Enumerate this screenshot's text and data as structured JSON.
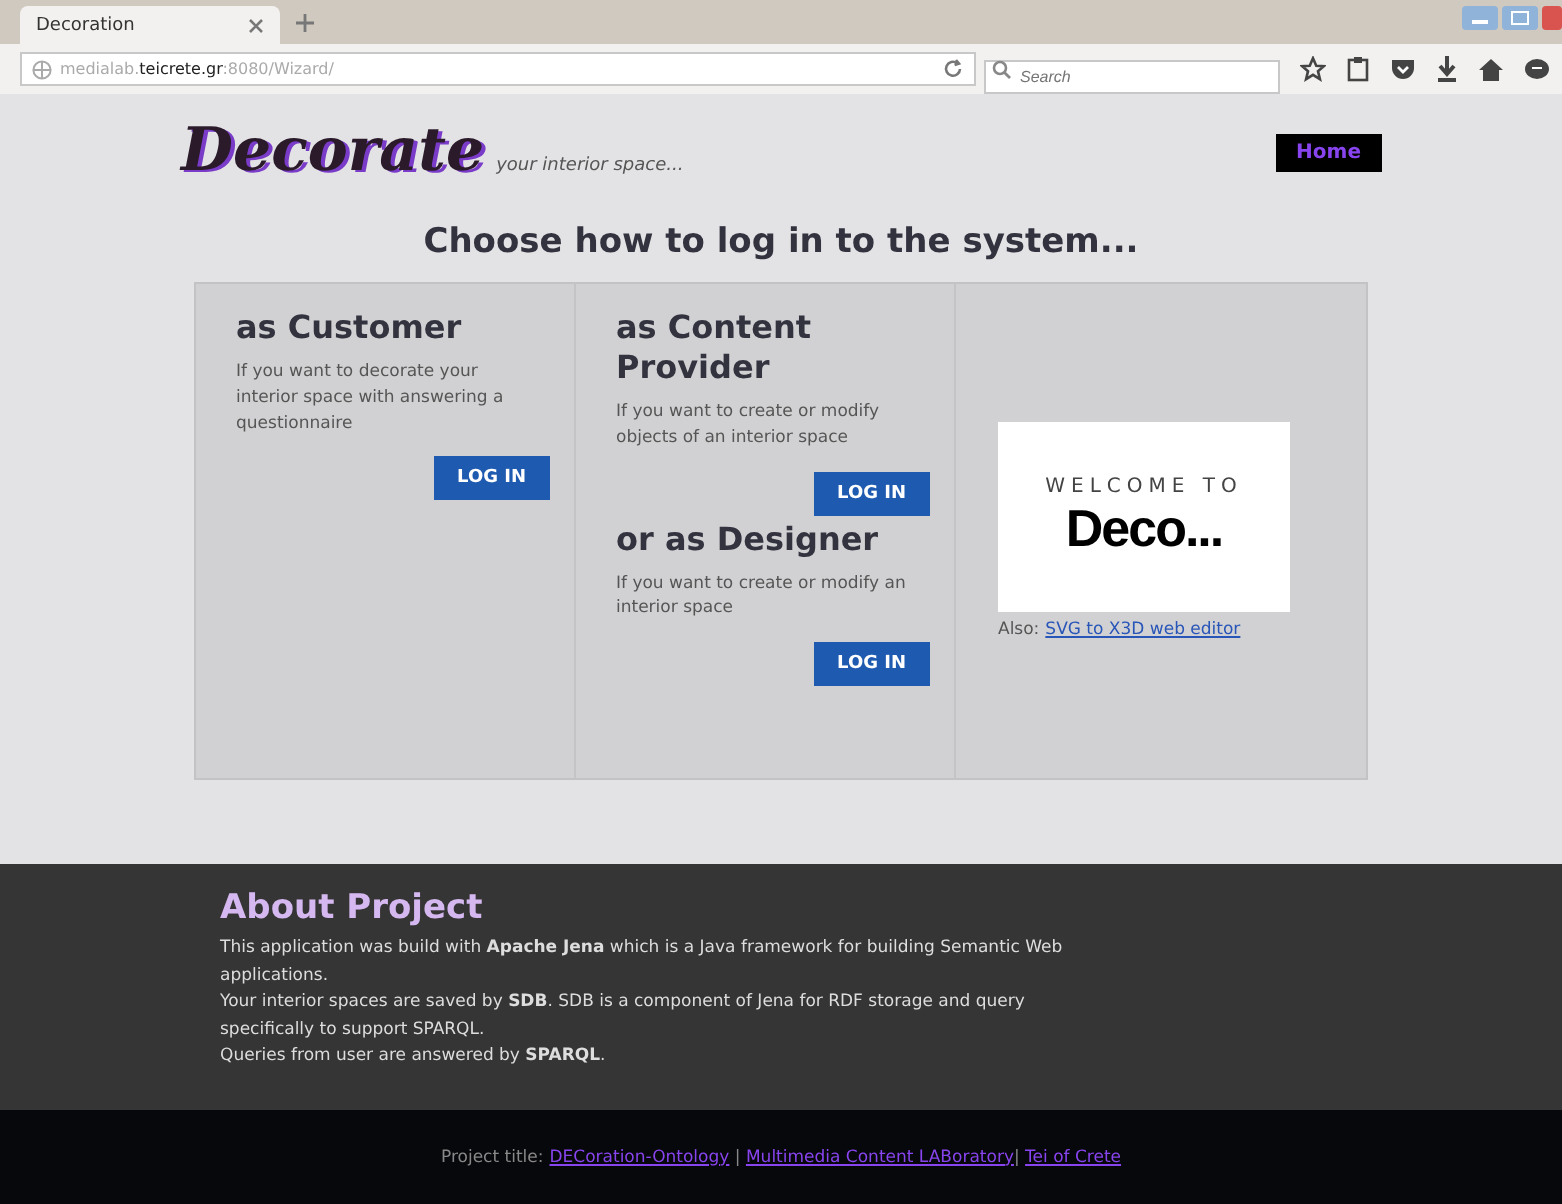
{
  "browser": {
    "tab": {
      "title": "Decoration",
      "selected": true
    },
    "address": {
      "host": "medialab.",
      "domain": "teicrete.gr",
      "rest": ":8080/Wizard/"
    },
    "search": {
      "placeholder": "Search"
    }
  },
  "header": {
    "logo": "Decorate",
    "tagline": "your interior space...",
    "nav": [
      {
        "label": "Home",
        "selected": true
      }
    ]
  },
  "heading": "Choose how to log in to the system...",
  "role_columns": [
    {
      "roles": [
        {
          "title": "as Customer",
          "text": "If you want to decorate your interior space with answering a questionnaire",
          "button": "LOG IN"
        }
      ]
    },
    {
      "roles": [
        {
          "title": "as Content Provider",
          "text": "If you want to create or modify objects of an interior space",
          "button": "LOG IN"
        },
        {
          "title": "or as Designer",
          "text": "If you want to create or modify an interior space",
          "button": "LOG IN"
        }
      ]
    }
  ],
  "welcome": {
    "line1": "WELCOME TO",
    "line2": "Deco...",
    "also_label": "Also:",
    "also_link": "SVG to X3D web editor"
  },
  "about": {
    "title": "About Project",
    "lines": [
      "This application was build with **Apache Jena** which is a Java framework for building Semantic Web applications.",
      "Your interior spaces are saved by **SDB**. SDB is a component of Jena for RDF storage and query specifically to support SPARQL.",
      "Queries from user are answered by **SPARQL**."
    ]
  },
  "footer": {
    "label": "Project title:",
    "links": [
      {
        "text": "DECoration-Ontology",
        "sep": " | "
      },
      {
        "text": "Multimedia Content LABoratory",
        "sep": "| "
      },
      {
        "text": "Tei of Crete"
      }
    ]
  }
}
